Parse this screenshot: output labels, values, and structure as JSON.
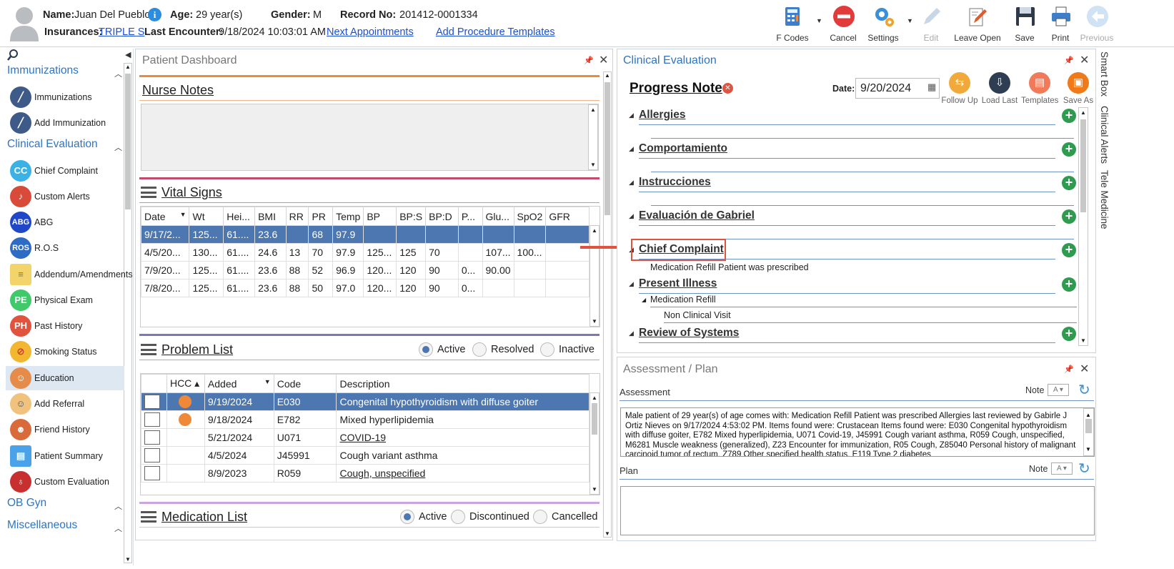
{
  "header": {
    "name_label": "Name:",
    "name_value": "Juan Del Pueblo",
    "age_label": "Age:",
    "age_value": "29 year(s)",
    "gender_label": "Gender:",
    "gender_value": "M",
    "record_label": "Record No:",
    "record_value": "201412-0001334",
    "insurances_label": "Insurances:",
    "insurance_link": "TRIPLE S",
    "last_encounter_label": "Last Encounter:",
    "last_encounter_value": "9/18/2024 10:03:01 AM",
    "next_appointments": "Next Appointments",
    "add_procedure_templates": "Add Procedure Templates"
  },
  "toolbar": {
    "fcodes": "F Codes",
    "cancel": "Cancel",
    "settings": "Settings",
    "edit": "Edit",
    "leave_open": "Leave Open",
    "save": "Save",
    "print": "Print",
    "previous": "Previous"
  },
  "sidebar": {
    "sections": {
      "immunizations": "Immunizations",
      "clinical_evaluation": "Clinical Evaluation",
      "ob_gyn": "OB Gyn",
      "miscellaneous": "Miscellaneous"
    },
    "items": [
      {
        "label": "Immunizations",
        "icon": "syringe-icon",
        "abbr": ""
      },
      {
        "label": "Add Immunization",
        "icon": "syringe-add-icon",
        "abbr": ""
      },
      {
        "label": "Chief Complaint",
        "icon": "cc-icon",
        "abbr": "CC"
      },
      {
        "label": "Custom Alerts",
        "icon": "bell-icon",
        "abbr": ""
      },
      {
        "label": "ABG",
        "icon": "abg-icon",
        "abbr": "ABG"
      },
      {
        "label": "R.O.S",
        "icon": "ros-icon",
        "abbr": "ROS"
      },
      {
        "label": "Addendum/Amendments",
        "icon": "note-icon",
        "abbr": ""
      },
      {
        "label": "Physical Exam",
        "icon": "pe-icon",
        "abbr": "PE"
      },
      {
        "label": "Past History",
        "icon": "ph-icon",
        "abbr": "PH"
      },
      {
        "label": "Smoking Status",
        "icon": "no-smoking-icon",
        "abbr": ""
      },
      {
        "label": "Education",
        "icon": "education-icon",
        "abbr": ""
      },
      {
        "label": "Add Referral",
        "icon": "referral-icon",
        "abbr": ""
      },
      {
        "label": "Friend History",
        "icon": "people-icon",
        "abbr": ""
      },
      {
        "label": "Patient Summary",
        "icon": "folder-icon",
        "abbr": ""
      },
      {
        "label": "Custom Evaluation",
        "icon": "stethoscope-icon",
        "abbr": ""
      }
    ]
  },
  "dashboard": {
    "title": "Patient Dashboard",
    "nurse_notes": "Nurse Notes",
    "vital_signs": "Vital Signs",
    "vitals_headers": [
      "Date",
      "Wt",
      "Hei...",
      "BMI",
      "RR",
      "PR",
      "Temp",
      "BP",
      "BP:S",
      "BP:D",
      "P...",
      "Glu...",
      "SpO2",
      "GFR"
    ],
    "vitals_rows": [
      [
        "9/17/2...",
        "125...",
        "61....",
        "23.6",
        "",
        "68",
        "97.9",
        "",
        "",
        "",
        "",
        "",
        "",
        ""
      ],
      [
        "4/5/20...",
        "130...",
        "61....",
        "24.6",
        "13",
        "70",
        "97.9",
        "125...",
        "125",
        "70",
        "",
        "107...",
        "100...",
        ""
      ],
      [
        "7/9/20...",
        "125...",
        "61....",
        "23.6",
        "88",
        "52",
        "96.9",
        "120...",
        "120",
        "90",
        "0...",
        "90.00",
        "",
        ""
      ],
      [
        "7/8/20...",
        "125...",
        "61....",
        "23.6",
        "88",
        "50",
        "97.0",
        "120...",
        "120",
        "90",
        "0...",
        "",
        "",
        ""
      ]
    ],
    "problem_list": "Problem List",
    "problem_filters": [
      "Active",
      "Resolved",
      "Inactive"
    ],
    "problem_headers": [
      "",
      "HCC",
      "Added",
      "Code",
      "Description"
    ],
    "problem_rows": [
      {
        "hcc": true,
        "added": "9/19/2024",
        "code": "E030",
        "desc": "Congenital hypothyroidism with diffuse goiter",
        "link": false
      },
      {
        "hcc": true,
        "added": "9/18/2024",
        "code": "E782",
        "desc": "Mixed hyperlipidemia",
        "link": false
      },
      {
        "hcc": false,
        "added": "5/21/2024",
        "code": "U071",
        "desc": "COVID-19",
        "link": true
      },
      {
        "hcc": false,
        "added": "4/5/2024",
        "code": "J45991",
        "desc": "Cough variant asthma",
        "link": false
      },
      {
        "hcc": false,
        "added": "8/9/2023",
        "code": "R059",
        "desc": "Cough, unspecified",
        "link": true
      }
    ],
    "medication_list": "Medication List",
    "medication_filters": [
      "Active",
      "Discontinued",
      "Cancelled"
    ]
  },
  "clinical": {
    "title": "Clinical Evaluation",
    "note_title": "Progress Note",
    "date_label": "Date:",
    "date_value": "9/20/2024",
    "commands": [
      "Follow Up",
      "Load Last",
      "Templates",
      "Save As"
    ],
    "sections": [
      "Allergies",
      "Comportamiento",
      "Instrucciones",
      "Evaluación de Gabriel",
      "Chief Complaint",
      "Present Illness",
      "Review of Systems"
    ],
    "chief_complaint_text": "Medication Refill Patient was prescribed",
    "present_illness_sub": "Medication Refill",
    "present_illness_sub2": "Non Clinical Visit"
  },
  "right_tabs": [
    "Smart Box",
    "Clinical Alerts",
    "Tele Medicine"
  ],
  "assessment": {
    "title": "Assessment / Plan",
    "assessment_label": "Assessment",
    "note_label": "Note",
    "assessment_text": "Male patient of 29 year(s) of age comes with: Medication Refill Patient was prescribed     Allergies last reviewed by Gabirle J Ortiz Nieves on 9/17/2024 4:53:02 PM.    Items found were:  Crustacean  Items found were:  E030 Congenital hypothyroidism with diffuse goiter, E782 Mixed hyperlipidemia, U071 Covid-19, J45991 Cough variant asthma, R059 Cough, unspecified, M6281 Muscle weakness (generalized), Z23 Encounter for immunization, R05 Cough, Z85040 Personal history of malignant carcinoid tumor of rectum, Z789 Other specified health status, E119 Type 2 diabetes",
    "plan_label": "Plan"
  },
  "colors": {
    "accent": "#2f74c4",
    "selected_row": "#4c77b0",
    "hcc_dot": "#f0883a",
    "add_green": "#2e9b4f",
    "highlight_red": "#e0533f"
  }
}
